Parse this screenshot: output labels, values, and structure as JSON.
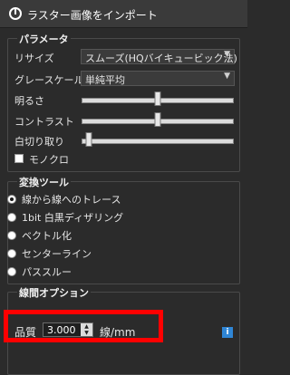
{
  "window": {
    "title": "ラスター画像をインポート"
  },
  "param_group": {
    "title": "パラメータ",
    "smoothing": {
      "label": "リサイズ",
      "value": "スムーズ(HQバイキュービック法)"
    },
    "grayscale": {
      "label": "グレースケール",
      "value": "単純平均"
    },
    "brightness": {
      "label": "明るさ",
      "level": 0.5
    },
    "contrast": {
      "label": "コントラスト",
      "level": 0.5
    },
    "threshold": {
      "label": "白切り取り",
      "level": 0.05
    },
    "mono": {
      "label": "モノクロ",
      "checked": false
    }
  },
  "conversion_group": {
    "title": "変換ツール",
    "options": [
      {
        "label": "線から線へのトレース",
        "selected": true
      },
      {
        "label": "1bit 白黒ディザリング",
        "selected": false
      },
      {
        "label": "ベクトル化",
        "selected": false
      },
      {
        "label": "センターライン",
        "selected": false
      },
      {
        "label": "パススルー",
        "selected": false
      }
    ]
  },
  "line_group": {
    "title": "線間オプション",
    "quality": {
      "label": "品質",
      "value": "3.000",
      "unit": "線/mm"
    },
    "info_icon": "i"
  },
  "colors": {
    "highlight": "#ff0000",
    "background": "#2b2b2b",
    "info": "#2f86d6"
  }
}
